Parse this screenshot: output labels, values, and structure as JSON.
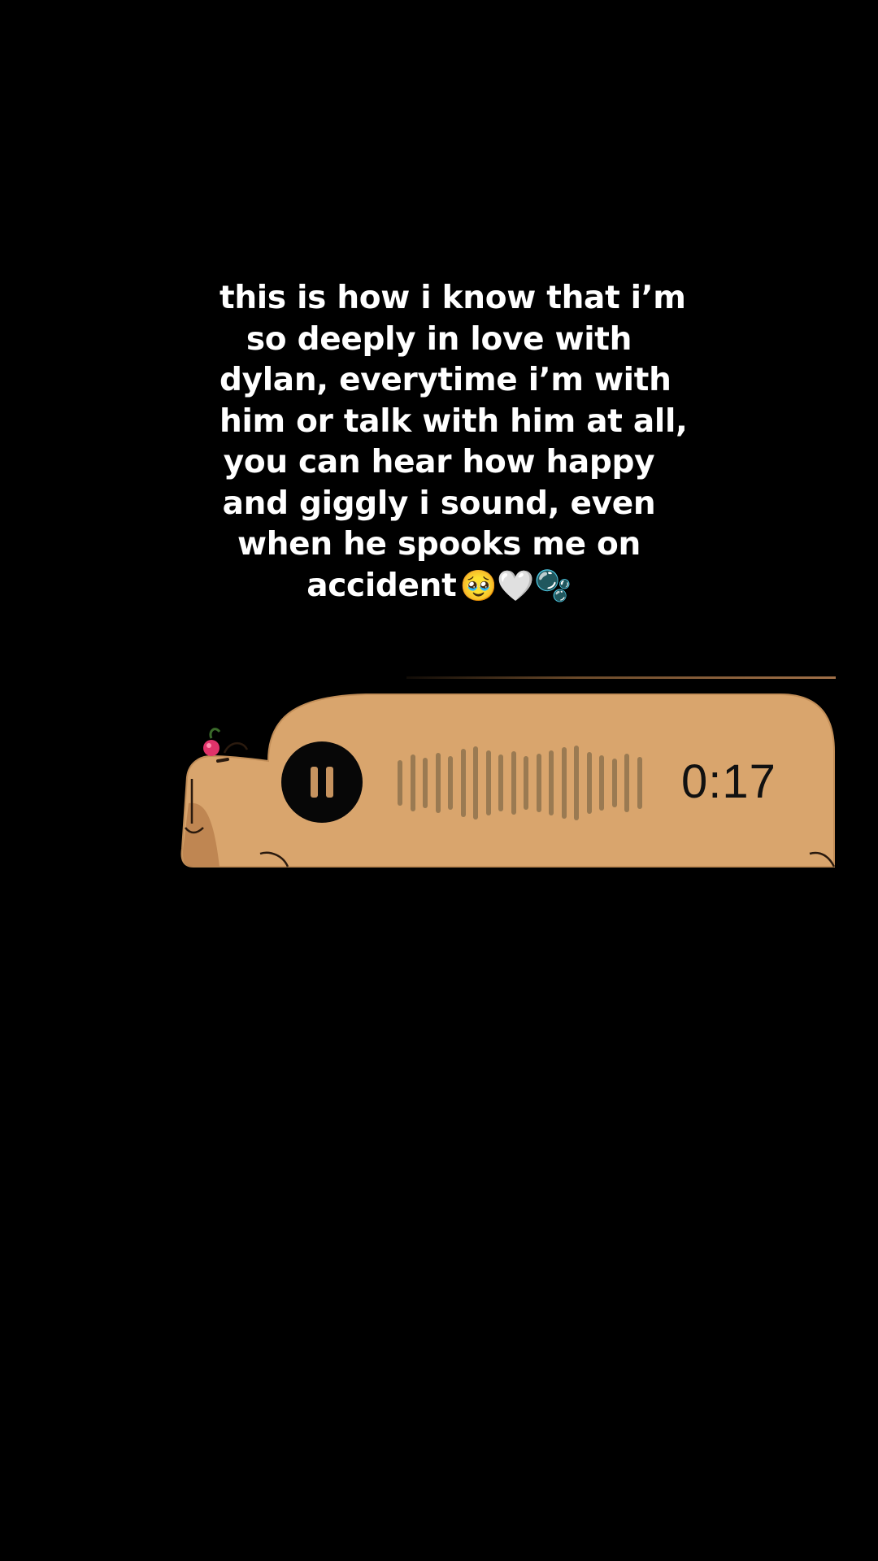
{
  "caption": {
    "lines": [
      "this is how i know that i’m",
      "so deeply in love with",
      "dylan, everytime i’m with",
      "him or talk with him at all,",
      "you can hear how happy",
      "and giggly i sound, even",
      "when he spooks me on",
      "accident"
    ],
    "emoji": "🥹🤍🫧"
  },
  "voice_message": {
    "duration": "0:17",
    "state": "playing",
    "control_icon": "pause-icon",
    "bubble_color": "#d9a56d",
    "text_color": "#111111"
  }
}
